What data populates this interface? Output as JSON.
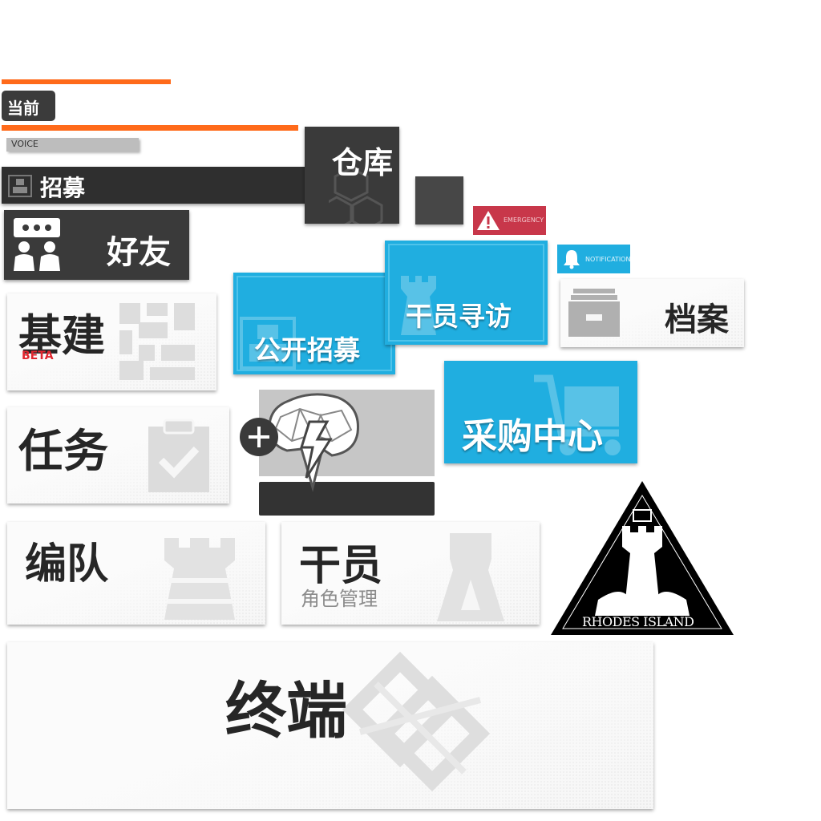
{
  "status": {
    "current_label": "当前",
    "voice_label": "VOICE"
  },
  "nav": {
    "recruit_label": "招募",
    "depot_label": "仓库",
    "friends_label": "好友",
    "emergency_label": "EMERGENCY",
    "notification_label": "NOTIFICATION",
    "infrastructure_label": "基建",
    "beta_badge": "BETA",
    "public_recruit_label": "公开招募",
    "headhunt_label": "干员寻访",
    "archives_label": "档案",
    "missions_label": "任务",
    "store_label": "采购中心",
    "squads_label": "编队",
    "operators_label": "干员",
    "operators_sublabel": "角色管理",
    "terminal_label": "终端",
    "logo_text": "RHODES ISLAND"
  },
  "icons": [
    "recruit-icon",
    "crates-icon",
    "friends-icon",
    "warning-icon",
    "bell-icon",
    "base-icon",
    "shopping-cart-icon",
    "archive-box-icon",
    "clipboard-check-icon",
    "brain-lightning-icon",
    "plus-icon",
    "rook-icon",
    "terminal-emblem-icon",
    "rhodes-island-logo"
  ],
  "colors": {
    "accent_orange": "#ff6a1a",
    "blue": "#20aee0",
    "dark": "#3a3a3a",
    "emergency_red": "#c8374a"
  }
}
